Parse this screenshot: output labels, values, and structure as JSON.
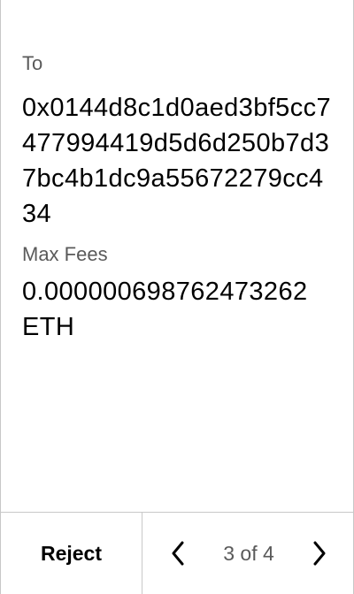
{
  "fields": {
    "to_label": "To",
    "to_value": "0x0144d8c1d0aed3bf5cc7477994419d5d6d250b7d37bc4b1dc9a55672279cc434",
    "fees_label": "Max Fees",
    "fees_value": "0.000000698762473262 ETH"
  },
  "footer": {
    "reject_label": "Reject",
    "page_indicator": "3 of 4",
    "prev_icon": "chevron-left-icon",
    "next_icon": "chevron-right-icon"
  },
  "colors": {
    "text": "#000000",
    "muted": "#5a5a5a",
    "divider": "#c8c8c8",
    "background": "#ffffff"
  }
}
